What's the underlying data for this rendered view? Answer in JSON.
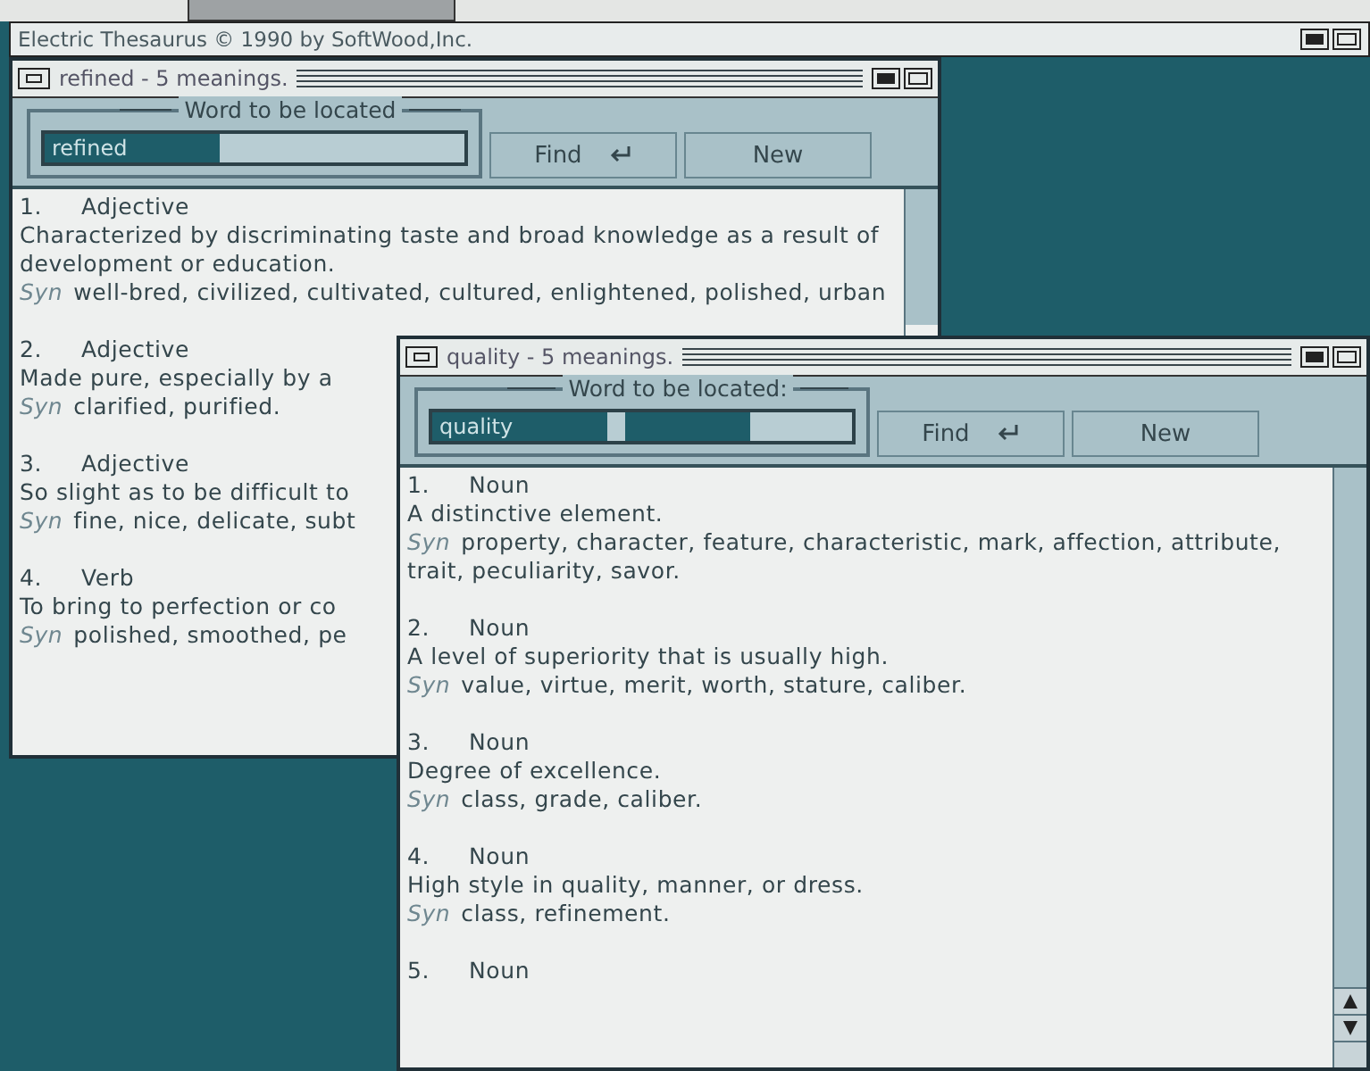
{
  "app_title": "Electric Thesaurus © 1990 by SoftWood,Inc.",
  "windows": [
    {
      "title": "refined - 5 meanings.",
      "field_label": "Word to be located",
      "value": "refined",
      "buttons": [
        "Find",
        "New"
      ],
      "meanings": [
        {
          "number": "1.",
          "part": "Adjective",
          "definition": "Characterized by discriminating taste and broad knowledge as a result of development or education.",
          "syn_label": "Syn",
          "synonyms": "well-bred, civilized, cultivated, cultured, enlightened, polished, urban"
        },
        {
          "number": "2.",
          "part": "Adjective",
          "definition": "Made pure, especially by a",
          "syn_label": "Syn",
          "synonyms": "clarified, purified."
        },
        {
          "number": "3.",
          "part": "Adjective",
          "definition": "So slight as to be difficult to",
          "syn_label": "Syn",
          "synonyms": "fine, nice, delicate, subt"
        },
        {
          "number": "4.",
          "part": "Verb",
          "definition": "To bring to perfection or co",
          "syn_label": "Syn",
          "synonyms": "polished, smoothed, pe"
        }
      ]
    },
    {
      "title": "quality - 5 meanings.",
      "field_label": "Word to be located:",
      "value": "quality",
      "buttons": [
        "Find",
        "New"
      ],
      "meanings": [
        {
          "number": "1.",
          "part": "Noun",
          "definition": "A distinctive element.",
          "syn_label": "Syn",
          "synonyms": "property, character, feature, characteristic, mark, affection, attribute, trait, peculiarity, savor."
        },
        {
          "number": "2.",
          "part": "Noun",
          "definition": "A level of superiority that is usually high.",
          "syn_label": "Syn",
          "synonyms": "value, virtue, merit, worth, stature, caliber."
        },
        {
          "number": "3.",
          "part": "Noun",
          "definition": "Degree of excellence.",
          "syn_label": "Syn",
          "synonyms": "class, grade, caliber."
        },
        {
          "number": "4.",
          "part": "Noun",
          "definition": "High style in quality, manner, or dress.",
          "syn_label": "Syn",
          "synonyms": "class, refinement."
        },
        {
          "number": "5.",
          "part": "Noun"
        }
      ]
    }
  ]
}
